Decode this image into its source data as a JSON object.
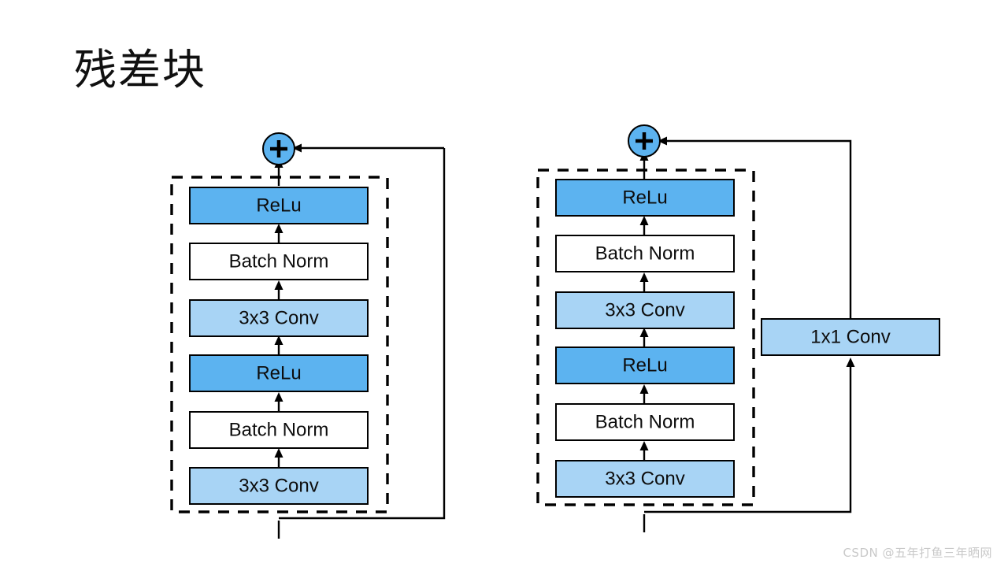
{
  "slide": {
    "title": "残差块",
    "background_color": "#ffffff",
    "watermark": "CSDN @五年打鱼三年晒网"
  },
  "colors": {
    "relu_fill": "#5cb3f0",
    "conv_fill": "#a8d4f5",
    "norm_fill": "#ffffff",
    "plus_fill": "#5cb3f0",
    "stroke": "#000000",
    "watermark_color": "#c9c9c9"
  },
  "diagrams": [
    {
      "id": "residual-block-identity",
      "name": "residual-block-without-1x1-conv",
      "adder_label": "+",
      "blocks": [
        {
          "label": "ReLu",
          "type": "relu"
        },
        {
          "label": "Batch Norm",
          "type": "batchnorm"
        },
        {
          "label": "3x3 Conv",
          "type": "conv"
        },
        {
          "label": "ReLu",
          "type": "relu"
        },
        {
          "label": "Batch Norm",
          "type": "batchnorm"
        },
        {
          "label": "3x3 Conv",
          "type": "conv"
        }
      ],
      "skip_connection": {
        "has_conv": false,
        "conv_label": ""
      }
    },
    {
      "id": "residual-block-projection",
      "name": "residual-block-with-1x1-conv",
      "adder_label": "+",
      "blocks": [
        {
          "label": "ReLu",
          "type": "relu"
        },
        {
          "label": "Batch Norm",
          "type": "batchnorm"
        },
        {
          "label": "3x3 Conv",
          "type": "conv"
        },
        {
          "label": "ReLu",
          "type": "relu"
        },
        {
          "label": "Batch Norm",
          "type": "batchnorm"
        },
        {
          "label": "3x3 Conv",
          "type": "conv"
        }
      ],
      "skip_connection": {
        "has_conv": true,
        "conv_label": "1x1 Conv"
      }
    }
  ]
}
